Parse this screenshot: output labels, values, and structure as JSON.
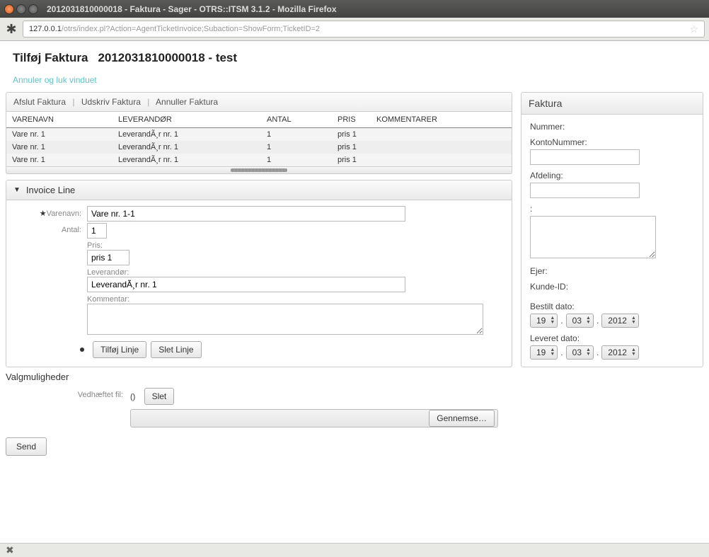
{
  "window": {
    "title": "2012031810000018 - Faktura - Sager - OTRS::ITSM 3.1.2 - Mozilla Firefox"
  },
  "url": {
    "host": "127.0.0.1",
    "path": "/otrs/index.pl?Action=AgentTicketInvoice;Subaction=ShowForm;TicketID=2"
  },
  "header": {
    "title_prefix": "Tilføj Faktura",
    "title_suffix": "2012031810000018 - test",
    "cancel": "Annuler og luk vinduet"
  },
  "toolbar": {
    "finish": "Afslut Faktura",
    "print": "Udskriv Faktura",
    "cancel": "Annuller Faktura"
  },
  "table": {
    "cols": {
      "name": "VARENAVN",
      "supplier": "LEVERANDØR",
      "qty": "ANTAL",
      "price": "PRIS",
      "comments": "KOMMENTARER"
    },
    "rows": [
      {
        "name": "Vare nr. 1",
        "supplier": "LeverandÃ¸r nr. 1",
        "qty": "1",
        "price": "pris 1",
        "comments": ""
      },
      {
        "name": "Vare nr. 1",
        "supplier": "LeverandÃ¸r nr. 1",
        "qty": "1",
        "price": "pris 1",
        "comments": ""
      },
      {
        "name": "Vare nr. 1",
        "supplier": "LeverandÃ¸r nr. 1",
        "qty": "1",
        "price": "pris 1",
        "comments": ""
      }
    ]
  },
  "invoice_line": {
    "title": "Invoice Line",
    "labels": {
      "name": "Varenavn:",
      "qty": "Antal:",
      "price": "Pris:",
      "supplier": "Leverandør:",
      "comment": "Kommentar:"
    },
    "values": {
      "name": "Vare nr. 1-1",
      "qty": "1",
      "price": "pris 1",
      "supplier": "LeverandÃ¸r nr. 1",
      "comment": ""
    },
    "buttons": {
      "add": "Tilføj Linje",
      "del": "Slet Linje"
    }
  },
  "options": {
    "title": "Valgmuligheder",
    "attach_lbl": "Vedhæftet fil:",
    "attach_val": "()",
    "delete": "Slet",
    "browse": "Gennemse…"
  },
  "send": "Send",
  "side": {
    "title": "Faktura",
    "labels": {
      "number": "Nummer:",
      "account": "KontoNummer:",
      "dept": "Afdeling:",
      "colon": ":",
      "owner": "Ejer:",
      "customer": "Kunde-ID:",
      "ordered": "Bestilt dato:",
      "delivered": "Leveret dato:"
    },
    "ordered": {
      "d": "19",
      "m": "03",
      "y": "2012"
    },
    "delivered": {
      "d": "19",
      "m": "03",
      "y": "2012"
    }
  },
  "footer_close": "✖"
}
